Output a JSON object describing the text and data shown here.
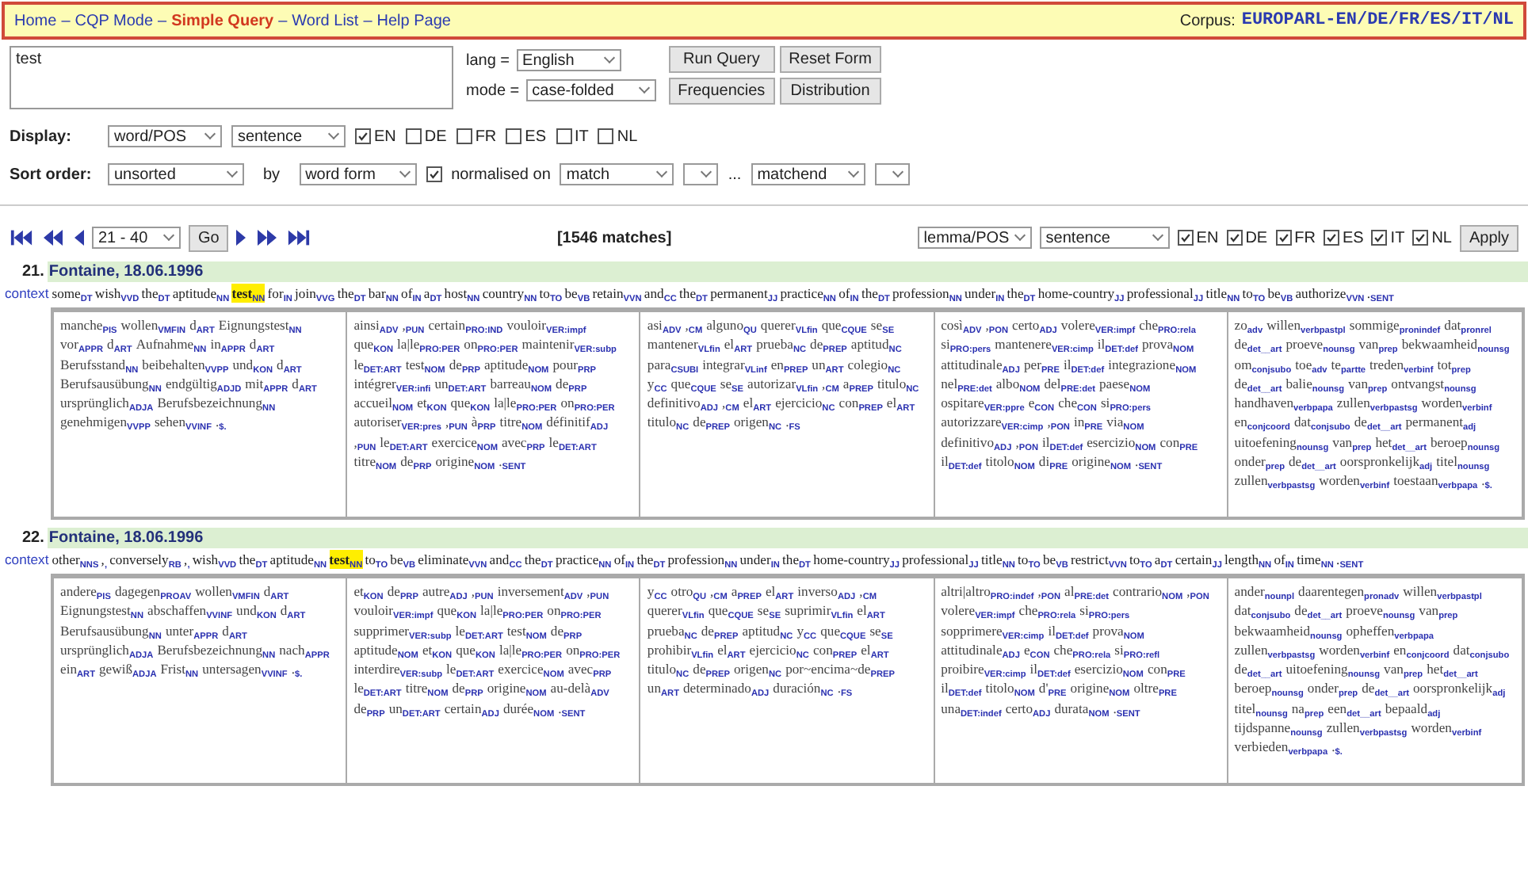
{
  "nav": {
    "separator": "–",
    "links": [
      {
        "label": "Home",
        "selected": false
      },
      {
        "label": "CQP Mode",
        "selected": false
      },
      {
        "label": "Simple Query",
        "selected": true
      },
      {
        "label": "Word List",
        "selected": false
      },
      {
        "label": "Help Page",
        "selected": false
      }
    ],
    "corpus_label": "Corpus:",
    "corpus": "EUROPARL-EN/DE/FR/ES/IT/NL"
  },
  "query": {
    "value": "test",
    "lang_label": "lang =",
    "lang": "English",
    "mode_label": "mode =",
    "mode": "case-folded",
    "buttons": [
      "Run Query",
      "Reset Form",
      "Frequencies",
      "Distribution"
    ]
  },
  "display": {
    "label": "Display:",
    "format": "word/POS",
    "context": "sentence",
    "languages": [
      {
        "label": "EN",
        "checked": true
      },
      {
        "label": "DE",
        "checked": false
      },
      {
        "label": "FR",
        "checked": false
      },
      {
        "label": "ES",
        "checked": false
      },
      {
        "label": "IT",
        "checked": false
      },
      {
        "label": "NL",
        "checked": false
      }
    ]
  },
  "sort": {
    "label": "Sort order:",
    "order": "unsorted",
    "by_label": "by",
    "by": "word form",
    "normalised": {
      "label": "normalised on",
      "checked": true
    },
    "start": "match",
    "separator": "...",
    "end": "matchend"
  },
  "pager": {
    "range": "21 - 40",
    "go": "Go",
    "matches": "[1546 matches]",
    "format": "lemma/POS",
    "context": "sentence",
    "languages": [
      {
        "label": "EN",
        "checked": true
      },
      {
        "label": "DE",
        "checked": true
      },
      {
        "label": "FR",
        "checked": true
      },
      {
        "label": "ES",
        "checked": true
      },
      {
        "label": "IT",
        "checked": true
      },
      {
        "label": "NL",
        "checked": true
      }
    ],
    "apply": "Apply"
  },
  "results": [
    {
      "number": "21.",
      "source": "Fontaine, 18.06.1996",
      "context_label": "context",
      "left": [
        [
          "some",
          "DT"
        ],
        [
          "wish",
          "VVD"
        ],
        [
          "the",
          "DT"
        ],
        [
          "aptitude",
          "NN"
        ]
      ],
      "match": [
        "test",
        "NN"
      ],
      "right": [
        [
          "for",
          "IN"
        ],
        [
          "join",
          "VVG"
        ],
        [
          "the",
          "DT"
        ],
        [
          "bar",
          "NN"
        ],
        [
          "of",
          "IN"
        ],
        [
          "a",
          "DT"
        ],
        [
          "host",
          "NN"
        ],
        [
          "country",
          "NN"
        ],
        [
          "to",
          "TO"
        ],
        [
          "be",
          "VB"
        ],
        [
          "retain",
          "VVN"
        ],
        [
          "and",
          "CC"
        ],
        [
          "the",
          "DT"
        ],
        [
          "permanent",
          "JJ"
        ],
        [
          "practice",
          "NN"
        ],
        [
          "of",
          "IN"
        ],
        [
          "the",
          "DT"
        ],
        [
          "profession",
          "NN"
        ],
        [
          "under",
          "IN"
        ],
        [
          "the",
          "DT"
        ],
        [
          "home-country",
          "JJ"
        ],
        [
          "professional",
          "JJ"
        ],
        [
          "title",
          "NN"
        ],
        [
          "to",
          "TO"
        ],
        [
          "be",
          "VB"
        ],
        [
          "authorize",
          "VVN"
        ],
        [
          ".",
          "SENT"
        ]
      ],
      "aligned": [
        [
          [
            "manche",
            "PIS"
          ],
          [
            "wollen",
            "VMFIN"
          ],
          [
            "d",
            "ART"
          ],
          [
            "Eignungstest",
            "NN"
          ],
          [
            "vor",
            "APPR"
          ],
          [
            "d",
            "ART"
          ],
          [
            "Aufnahme",
            "NN"
          ],
          [
            "in",
            "APPR"
          ],
          [
            "d",
            "ART"
          ],
          [
            "Berufsstand",
            "NN"
          ],
          [
            "beibehalten",
            "VVPP"
          ],
          [
            "und",
            "KON"
          ],
          [
            "d",
            "ART"
          ],
          [
            "Berufsausübung",
            "NN"
          ],
          [
            "endgültig",
            "ADJD"
          ],
          [
            "mit",
            "APPR"
          ],
          [
            "d",
            "ART"
          ],
          [
            "ursprünglich",
            "ADJA"
          ],
          [
            "Berufsbezeichnung",
            "NN"
          ],
          [
            "genehmigen",
            "VVPP"
          ],
          [
            "sehen",
            "VVINF"
          ],
          [
            ".",
            "$."
          ]
        ],
        [
          [
            "ainsi",
            "ADV"
          ],
          [
            ",",
            "PUN"
          ],
          [
            "certain",
            "PRO:IND"
          ],
          [
            "vouloir",
            "VER:impf"
          ],
          [
            "que",
            "KON"
          ],
          [
            "la|le",
            "PRO:PER"
          ],
          [
            "on",
            "PRO:PER"
          ],
          [
            "maintenir",
            "VER:subp"
          ],
          [
            "le",
            "DET:ART"
          ],
          [
            "test",
            "NOM"
          ],
          [
            "de",
            "PRP"
          ],
          [
            "aptitude",
            "NOM"
          ],
          [
            "pour",
            "PRP"
          ],
          [
            "intégrer",
            "VER:infi"
          ],
          [
            "un",
            "DET:ART"
          ],
          [
            "barreau",
            "NOM"
          ],
          [
            "de",
            "PRP"
          ],
          [
            "accueil",
            "NOM"
          ],
          [
            "et",
            "KON"
          ],
          [
            "que",
            "KON"
          ],
          [
            "la|le",
            "PRO:PER"
          ],
          [
            "on",
            "PRO:PER"
          ],
          [
            "autoriser",
            "VER:pres"
          ],
          [
            ",",
            "PUN"
          ],
          [
            "à",
            "PRP"
          ],
          [
            "titre",
            "NOM"
          ],
          [
            "définitif",
            "ADJ"
          ],
          [
            ",",
            "PUN"
          ],
          [
            "le",
            "DET:ART"
          ],
          [
            "exercice",
            "NOM"
          ],
          [
            "avec",
            "PRP"
          ],
          [
            "le",
            "DET:ART"
          ],
          [
            "titre",
            "NOM"
          ],
          [
            "de",
            "PRP"
          ],
          [
            "origine",
            "NOM"
          ],
          [
            ".",
            "SENT"
          ]
        ],
        [
          [
            "asi",
            "ADV"
          ],
          [
            ",",
            "CM"
          ],
          [
            "alguno",
            "QU"
          ],
          [
            "querer",
            "VLfin"
          ],
          [
            "que",
            "CQUE"
          ],
          [
            "se",
            "SE"
          ],
          [
            "mantener",
            "VLfin"
          ],
          [
            "el",
            "ART"
          ],
          [
            "prueba",
            "NC"
          ],
          [
            "de",
            "PREP"
          ],
          [
            "aptitud",
            "NC"
          ],
          [
            "para",
            "CSUBI"
          ],
          [
            "integrar",
            "VLinf"
          ],
          [
            "en",
            "PREP"
          ],
          [
            "un",
            "ART"
          ],
          [
            "colegio",
            "NC"
          ],
          [
            "y",
            "CC"
          ],
          [
            "que",
            "CQUE"
          ],
          [
            "se",
            "SE"
          ],
          [
            "autorizar",
            "VLfin"
          ],
          [
            ",",
            "CM"
          ],
          [
            "a",
            "PREP"
          ],
          [
            "titulo",
            "NC"
          ],
          [
            "definitivo",
            "ADJ"
          ],
          [
            ",",
            "CM"
          ],
          [
            "el",
            "ART"
          ],
          [
            "ejercicio",
            "NC"
          ],
          [
            "con",
            "PREP"
          ],
          [
            "el",
            "ART"
          ],
          [
            "titulo",
            "NC"
          ],
          [
            "de",
            "PREP"
          ],
          [
            "origen",
            "NC"
          ],
          [
            ".",
            "FS"
          ]
        ],
        [
          [
            "così",
            "ADV"
          ],
          [
            ",",
            "PON"
          ],
          [
            "certo",
            "ADJ"
          ],
          [
            "volere",
            "VER:impf"
          ],
          [
            "che",
            "PRO:rela"
          ],
          [
            "si",
            "PRO:pers"
          ],
          [
            "mantenere",
            "VER:cimp"
          ],
          [
            "il",
            "DET:def"
          ],
          [
            "prova",
            "NOM"
          ],
          [
            "attitudinale",
            "ADJ"
          ],
          [
            "per",
            "PRE"
          ],
          [
            "il",
            "DET:def"
          ],
          [
            "integrazione",
            "NOM"
          ],
          [
            "nel",
            "PRE:det"
          ],
          [
            "albo",
            "NOM"
          ],
          [
            "del",
            "PRE:det"
          ],
          [
            "paese",
            "NOM"
          ],
          [
            "ospitare",
            "VER:ppre"
          ],
          [
            "e",
            "CON"
          ],
          [
            "che",
            "CON"
          ],
          [
            "si",
            "PRO:pers"
          ],
          [
            "autorizzare",
            "VER:cimp"
          ],
          [
            ",",
            "PON"
          ],
          [
            "in",
            "PRE"
          ],
          [
            "via",
            "NOM"
          ],
          [
            "definitivo",
            "ADJ"
          ],
          [
            ",",
            "PON"
          ],
          [
            "il",
            "DET:def"
          ],
          [
            "esercizio",
            "NOM"
          ],
          [
            "con",
            "PRE"
          ],
          [
            "il",
            "DET:def"
          ],
          [
            "titolo",
            "NOM"
          ],
          [
            "di",
            "PRE"
          ],
          [
            "origine",
            "NOM"
          ],
          [
            ".",
            "SENT"
          ]
        ],
        [
          [
            "zo",
            "adv"
          ],
          [
            "willen",
            "verbpastpl"
          ],
          [
            "sommige",
            "pronindef"
          ],
          [
            "dat",
            "pronrel"
          ],
          [
            "de",
            "det__art"
          ],
          [
            "proeve",
            "nounsg"
          ],
          [
            "van",
            "prep"
          ],
          [
            "bekwaamheid",
            "nounsg"
          ],
          [
            "om",
            "conjsubo"
          ],
          [
            "toe",
            "adv"
          ],
          [
            "te",
            "partte"
          ],
          [
            "treden",
            "verbinf"
          ],
          [
            "tot",
            "prep"
          ],
          [
            "de",
            "det__art"
          ],
          [
            "balie",
            "nounsg"
          ],
          [
            "van",
            "prep"
          ],
          [
            "ontvangst",
            "nounsg"
          ],
          [
            "handhaven",
            "verbpapa"
          ],
          [
            "zullen",
            "verbpastsg"
          ],
          [
            "worden",
            "verbinf"
          ],
          [
            "en",
            "conjcoord"
          ],
          [
            "dat",
            "conjsubo"
          ],
          [
            "de",
            "det__art"
          ],
          [
            "permanent",
            "adj"
          ],
          [
            "uitoefening",
            "nounsg"
          ],
          [
            "van",
            "prep"
          ],
          [
            "het",
            "det__art"
          ],
          [
            "beroep",
            "nounsg"
          ],
          [
            "onder",
            "prep"
          ],
          [
            "de",
            "det__art"
          ],
          [
            "oorspronkelijk",
            "adj"
          ],
          [
            "titel",
            "nounsg"
          ],
          [
            "zullen",
            "verbpastsg"
          ],
          [
            "worden",
            "verbinf"
          ],
          [
            "toestaan",
            "verbpapa"
          ],
          [
            ".",
            "$."
          ]
        ]
      ]
    },
    {
      "number": "22.",
      "source": "Fontaine, 18.06.1996",
      "context_label": "context",
      "left": [
        [
          "other",
          "NNS"
        ],
        [
          ",",
          ","
        ],
        [
          "conversely",
          "RB"
        ],
        [
          ",",
          ","
        ],
        [
          "wish",
          "VVD"
        ],
        [
          "the",
          "DT"
        ],
        [
          "aptitude",
          "NN"
        ]
      ],
      "match": [
        "test",
        "NN"
      ],
      "right": [
        [
          "to",
          "TO"
        ],
        [
          "be",
          "VB"
        ],
        [
          "eliminate",
          "VVN"
        ],
        [
          "and",
          "CC"
        ],
        [
          "the",
          "DT"
        ],
        [
          "practice",
          "NN"
        ],
        [
          "of",
          "IN"
        ],
        [
          "the",
          "DT"
        ],
        [
          "profession",
          "NN"
        ],
        [
          "under",
          "IN"
        ],
        [
          "the",
          "DT"
        ],
        [
          "home-country",
          "JJ"
        ],
        [
          "professional",
          "JJ"
        ],
        [
          "title",
          "NN"
        ],
        [
          "to",
          "TO"
        ],
        [
          "be",
          "VB"
        ],
        [
          "restrict",
          "VVN"
        ],
        [
          "to",
          "TO"
        ],
        [
          "a",
          "DT"
        ],
        [
          "certain",
          "JJ"
        ],
        [
          "length",
          "NN"
        ],
        [
          "of",
          "IN"
        ],
        [
          "time",
          "NN"
        ],
        [
          ".",
          "SENT"
        ]
      ],
      "aligned": [
        [
          [
            "andere",
            "PIS"
          ],
          [
            "dagegen",
            "PROAV"
          ],
          [
            "wollen",
            "VMFIN"
          ],
          [
            "d",
            "ART"
          ],
          [
            "Eignungstest",
            "NN"
          ],
          [
            "abschaffen",
            "VVINF"
          ],
          [
            "und",
            "KON"
          ],
          [
            "d",
            "ART"
          ],
          [
            "Berufsausübung",
            "NN"
          ],
          [
            "unter",
            "APPR"
          ],
          [
            "d",
            "ART"
          ],
          [
            "ursprünglich",
            "ADJA"
          ],
          [
            "Berufsbezeichnung",
            "NN"
          ],
          [
            "nach",
            "APPR"
          ],
          [
            "ein",
            "ART"
          ],
          [
            "gewiß",
            "ADJA"
          ],
          [
            "Frist",
            "NN"
          ],
          [
            "untersagen",
            "VVINF"
          ],
          [
            ".",
            "$."
          ]
        ],
        [
          [
            "et",
            "KON"
          ],
          [
            "de",
            "PRP"
          ],
          [
            "autre",
            "ADJ"
          ],
          [
            ",",
            "PUN"
          ],
          [
            "inversement",
            "ADV"
          ],
          [
            ",",
            "PUN"
          ],
          [
            "vouloir",
            "VER:impf"
          ],
          [
            "que",
            "KON"
          ],
          [
            "la|le",
            "PRO:PER"
          ],
          [
            "on",
            "PRO:PER"
          ],
          [
            "supprimer",
            "VER:subp"
          ],
          [
            "le",
            "DET:ART"
          ],
          [
            "test",
            "NOM"
          ],
          [
            "de",
            "PRP"
          ],
          [
            "aptitude",
            "NOM"
          ],
          [
            "et",
            "KON"
          ],
          [
            "que",
            "KON"
          ],
          [
            "la|le",
            "PRO:PER"
          ],
          [
            "on",
            "PRO:PER"
          ],
          [
            "interdire",
            "VER:subp"
          ],
          [
            "le",
            "DET:ART"
          ],
          [
            "exercice",
            "NOM"
          ],
          [
            "avec",
            "PRP"
          ],
          [
            "le",
            "DET:ART"
          ],
          [
            "titre",
            "NOM"
          ],
          [
            "de",
            "PRP"
          ],
          [
            "origine",
            "NOM"
          ],
          [
            "au-delà",
            "ADV"
          ],
          [
            "de",
            "PRP"
          ],
          [
            "un",
            "DET:ART"
          ],
          [
            "certain",
            "ADJ"
          ],
          [
            "durée",
            "NOM"
          ],
          [
            ".",
            "SENT"
          ]
        ],
        [
          [
            "y",
            "CC"
          ],
          [
            "otro",
            "QU"
          ],
          [
            ",",
            "CM"
          ],
          [
            "a",
            "PREP"
          ],
          [
            "el",
            "ART"
          ],
          [
            "inverso",
            "ADJ"
          ],
          [
            ",",
            "CM"
          ],
          [
            "querer",
            "VLfin"
          ],
          [
            "que",
            "CQUE"
          ],
          [
            "se",
            "SE"
          ],
          [
            "suprimir",
            "VLfin"
          ],
          [
            "el",
            "ART"
          ],
          [
            "prueba",
            "NC"
          ],
          [
            "de",
            "PREP"
          ],
          [
            "aptitud",
            "NC"
          ],
          [
            "y",
            "CC"
          ],
          [
            "que",
            "CQUE"
          ],
          [
            "se",
            "SE"
          ],
          [
            "prohibir",
            "VLfin"
          ],
          [
            "el",
            "ART"
          ],
          [
            "ejercicio",
            "NC"
          ],
          [
            "con",
            "PREP"
          ],
          [
            "el",
            "ART"
          ],
          [
            "titulo",
            "NC"
          ],
          [
            "de",
            "PREP"
          ],
          [
            "origen",
            "NC"
          ],
          [
            "por~encima~de",
            "PREP"
          ],
          [
            "un",
            "ART"
          ],
          [
            "determinado",
            "ADJ"
          ],
          [
            "duración",
            "NC"
          ],
          [
            ".",
            "FS"
          ]
        ],
        [
          [
            "altri|altro",
            "PRO:indef"
          ],
          [
            ",",
            "PON"
          ],
          [
            "al",
            "PRE:det"
          ],
          [
            "contrario",
            "NOM"
          ],
          [
            ",",
            "PON"
          ],
          [
            "volere",
            "VER:impf"
          ],
          [
            "che",
            "PRO:rela"
          ],
          [
            "si",
            "PRO:pers"
          ],
          [
            "sopprimere",
            "VER:cimp"
          ],
          [
            "il",
            "DET:def"
          ],
          [
            "prova",
            "NOM"
          ],
          [
            "attitudinale",
            "ADJ"
          ],
          [
            "e",
            "CON"
          ],
          [
            "che",
            "PRO:rela"
          ],
          [
            "si",
            "PRO:refl"
          ],
          [
            "proibire",
            "VER:cimp"
          ],
          [
            "il",
            "DET:def"
          ],
          [
            "esercizio",
            "NOM"
          ],
          [
            "con",
            "PRE"
          ],
          [
            "il",
            "DET:def"
          ],
          [
            "titolo",
            "NOM"
          ],
          [
            "d'",
            "PRE"
          ],
          [
            "origine",
            "NOM"
          ],
          [
            "oltre",
            "PRE"
          ],
          [
            "una",
            "DET:indef"
          ],
          [
            "certo",
            "ADJ"
          ],
          [
            "durata",
            "NOM"
          ],
          [
            ".",
            "SENT"
          ]
        ],
        [
          [
            "ander",
            "nounpl"
          ],
          [
            "daarentegen",
            "pronadv"
          ],
          [
            "willen",
            "verbpastpl"
          ],
          [
            "dat",
            "conjsubo"
          ],
          [
            "de",
            "det__art"
          ],
          [
            "proeve",
            "nounsg"
          ],
          [
            "van",
            "prep"
          ],
          [
            "bekwaamheid",
            "nounsg"
          ],
          [
            "opheffen",
            "verbpapa"
          ],
          [
            "zullen",
            "verbpastsg"
          ],
          [
            "worden",
            "verbinf"
          ],
          [
            "en",
            "conjcoord"
          ],
          [
            "dat",
            "conjsubo"
          ],
          [
            "de",
            "det__art"
          ],
          [
            "uitoefening",
            "nounsg"
          ],
          [
            "van",
            "prep"
          ],
          [
            "het",
            "det__art"
          ],
          [
            "beroep",
            "nounsg"
          ],
          [
            "onder",
            "prep"
          ],
          [
            "de",
            "det__art"
          ],
          [
            "oorspronkelijk",
            "adj"
          ],
          [
            "titel",
            "nounsg"
          ],
          [
            "na",
            "prep"
          ],
          [
            "een",
            "det__art"
          ],
          [
            "bepaald",
            "adj"
          ],
          [
            "tijdspanne",
            "nounsg"
          ],
          [
            "zullen",
            "verbpastsg"
          ],
          [
            "worden",
            "verbinf"
          ],
          [
            "verbieden",
            "verbpapa"
          ],
          [
            ".",
            "$."
          ]
        ]
      ]
    }
  ]
}
